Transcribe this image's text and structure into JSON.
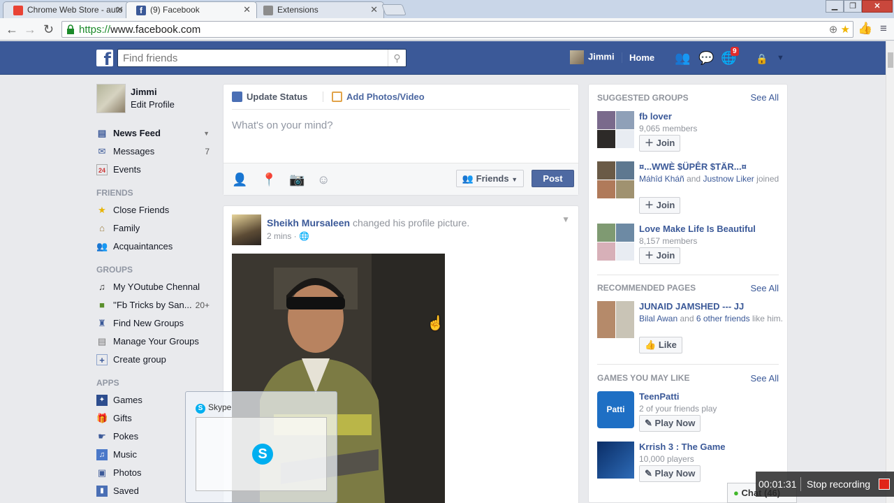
{
  "browser": {
    "tabs": [
      {
        "label": "Chrome Web Store - auto",
        "favicon_color": "#e94335",
        "active": false
      },
      {
        "label": "(9) Facebook",
        "favicon_color": "#3b5998",
        "active": true
      },
      {
        "label": "Extensions",
        "favicon_color": "#8c8c8c",
        "active": false
      }
    ],
    "url_scheme": "https://",
    "url_rest": "www.facebook.com"
  },
  "fb_header": {
    "search_placeholder": "Find friends",
    "user_name": "Jimmi",
    "home_label": "Home",
    "notification_count": "9",
    "brand_color": "#3b5998"
  },
  "left_nav": {
    "profile": {
      "name": "Jimmi",
      "edit_label": "Edit Profile"
    },
    "main_items": [
      {
        "label": "News Feed",
        "icon": "news-feed-icon",
        "count": ""
      },
      {
        "label": "Messages",
        "icon": "messages-icon",
        "count": "7"
      },
      {
        "label": "Events",
        "icon": "calendar-icon",
        "count": ""
      }
    ],
    "friends_header": "FRIENDS",
    "friends_items": [
      {
        "label": "Close Friends",
        "icon": "star-icon"
      },
      {
        "label": "Family",
        "icon": "house-icon"
      },
      {
        "label": "Acquaintances",
        "icon": "people-icon"
      }
    ],
    "groups_header": "GROUPS",
    "groups_items": [
      {
        "label": "My YOutube Chennal",
        "icon": "music-note-icon",
        "count": ""
      },
      {
        "label": "''Fb Tricks by San...",
        "icon": "group-icon",
        "count": "20+"
      },
      {
        "label": "Find New Groups",
        "icon": "find-groups-icon",
        "count": ""
      },
      {
        "label": "Manage Your Groups",
        "icon": "manage-groups-icon",
        "count": ""
      },
      {
        "label": "Create group",
        "icon": "plus-icon",
        "count": ""
      }
    ],
    "apps_header": "APPS",
    "apps_items": [
      {
        "label": "Games",
        "icon": "games-icon"
      },
      {
        "label": "Gifts",
        "icon": "gift-icon"
      },
      {
        "label": "Pokes",
        "icon": "poke-icon"
      },
      {
        "label": "Music",
        "icon": "music-icon"
      },
      {
        "label": "Photos",
        "icon": "photos-icon"
      },
      {
        "label": "Saved",
        "icon": "bookmark-icon"
      }
    ]
  },
  "composer": {
    "tab_status": "Update Status",
    "tab_photos": "Add Photos/Video",
    "placeholder": "What's on your mind?",
    "audience": "Friends",
    "post_label": "Post"
  },
  "story": {
    "author": "Sheikh Mursaleen",
    "action": "changed his profile picture.",
    "time": "2 mins ·"
  },
  "right_col": {
    "suggested_groups_header": "SUGGESTED GROUPS",
    "see_all": "See All",
    "groups": [
      {
        "title": "fb lover",
        "sub": "9,065 members",
        "btn": "Join"
      },
      {
        "title": "¤...WWÈ $ÜPÊR $TÄR...¤",
        "sub_link1": "Máhîd Kháñ",
        "sub_and": "and",
        "sub_link2": "Justnow Liker",
        "sub_tail": "joined",
        "btn": "Join"
      },
      {
        "title": "Love Make Life Is Beautiful",
        "sub": "8,157 members",
        "btn": "Join"
      }
    ],
    "recommended_pages_header": "RECOMMENDED PAGES",
    "page": {
      "title": "JUNAID JAMSHED --- JJ",
      "sub_link1": "Bilal Awan",
      "sub_and": "and",
      "sub_link2": "6 other friends",
      "sub_tail": "like him.",
      "btn": "Like"
    },
    "games_header": "GAMES YOU MAY LIKE",
    "games": [
      {
        "title": "TeenPatti",
        "sub": "2 of your friends play",
        "btn": "Play Now"
      },
      {
        "title": "Krrish 3 : The Game",
        "sub": "10,000 players",
        "btn": "Play Now"
      }
    ]
  },
  "skype_preview": {
    "title": "Skype"
  },
  "chat": {
    "label": "Chat (46)"
  },
  "recorder": {
    "time": "00:01:31",
    "stop_label": "Stop recording"
  }
}
